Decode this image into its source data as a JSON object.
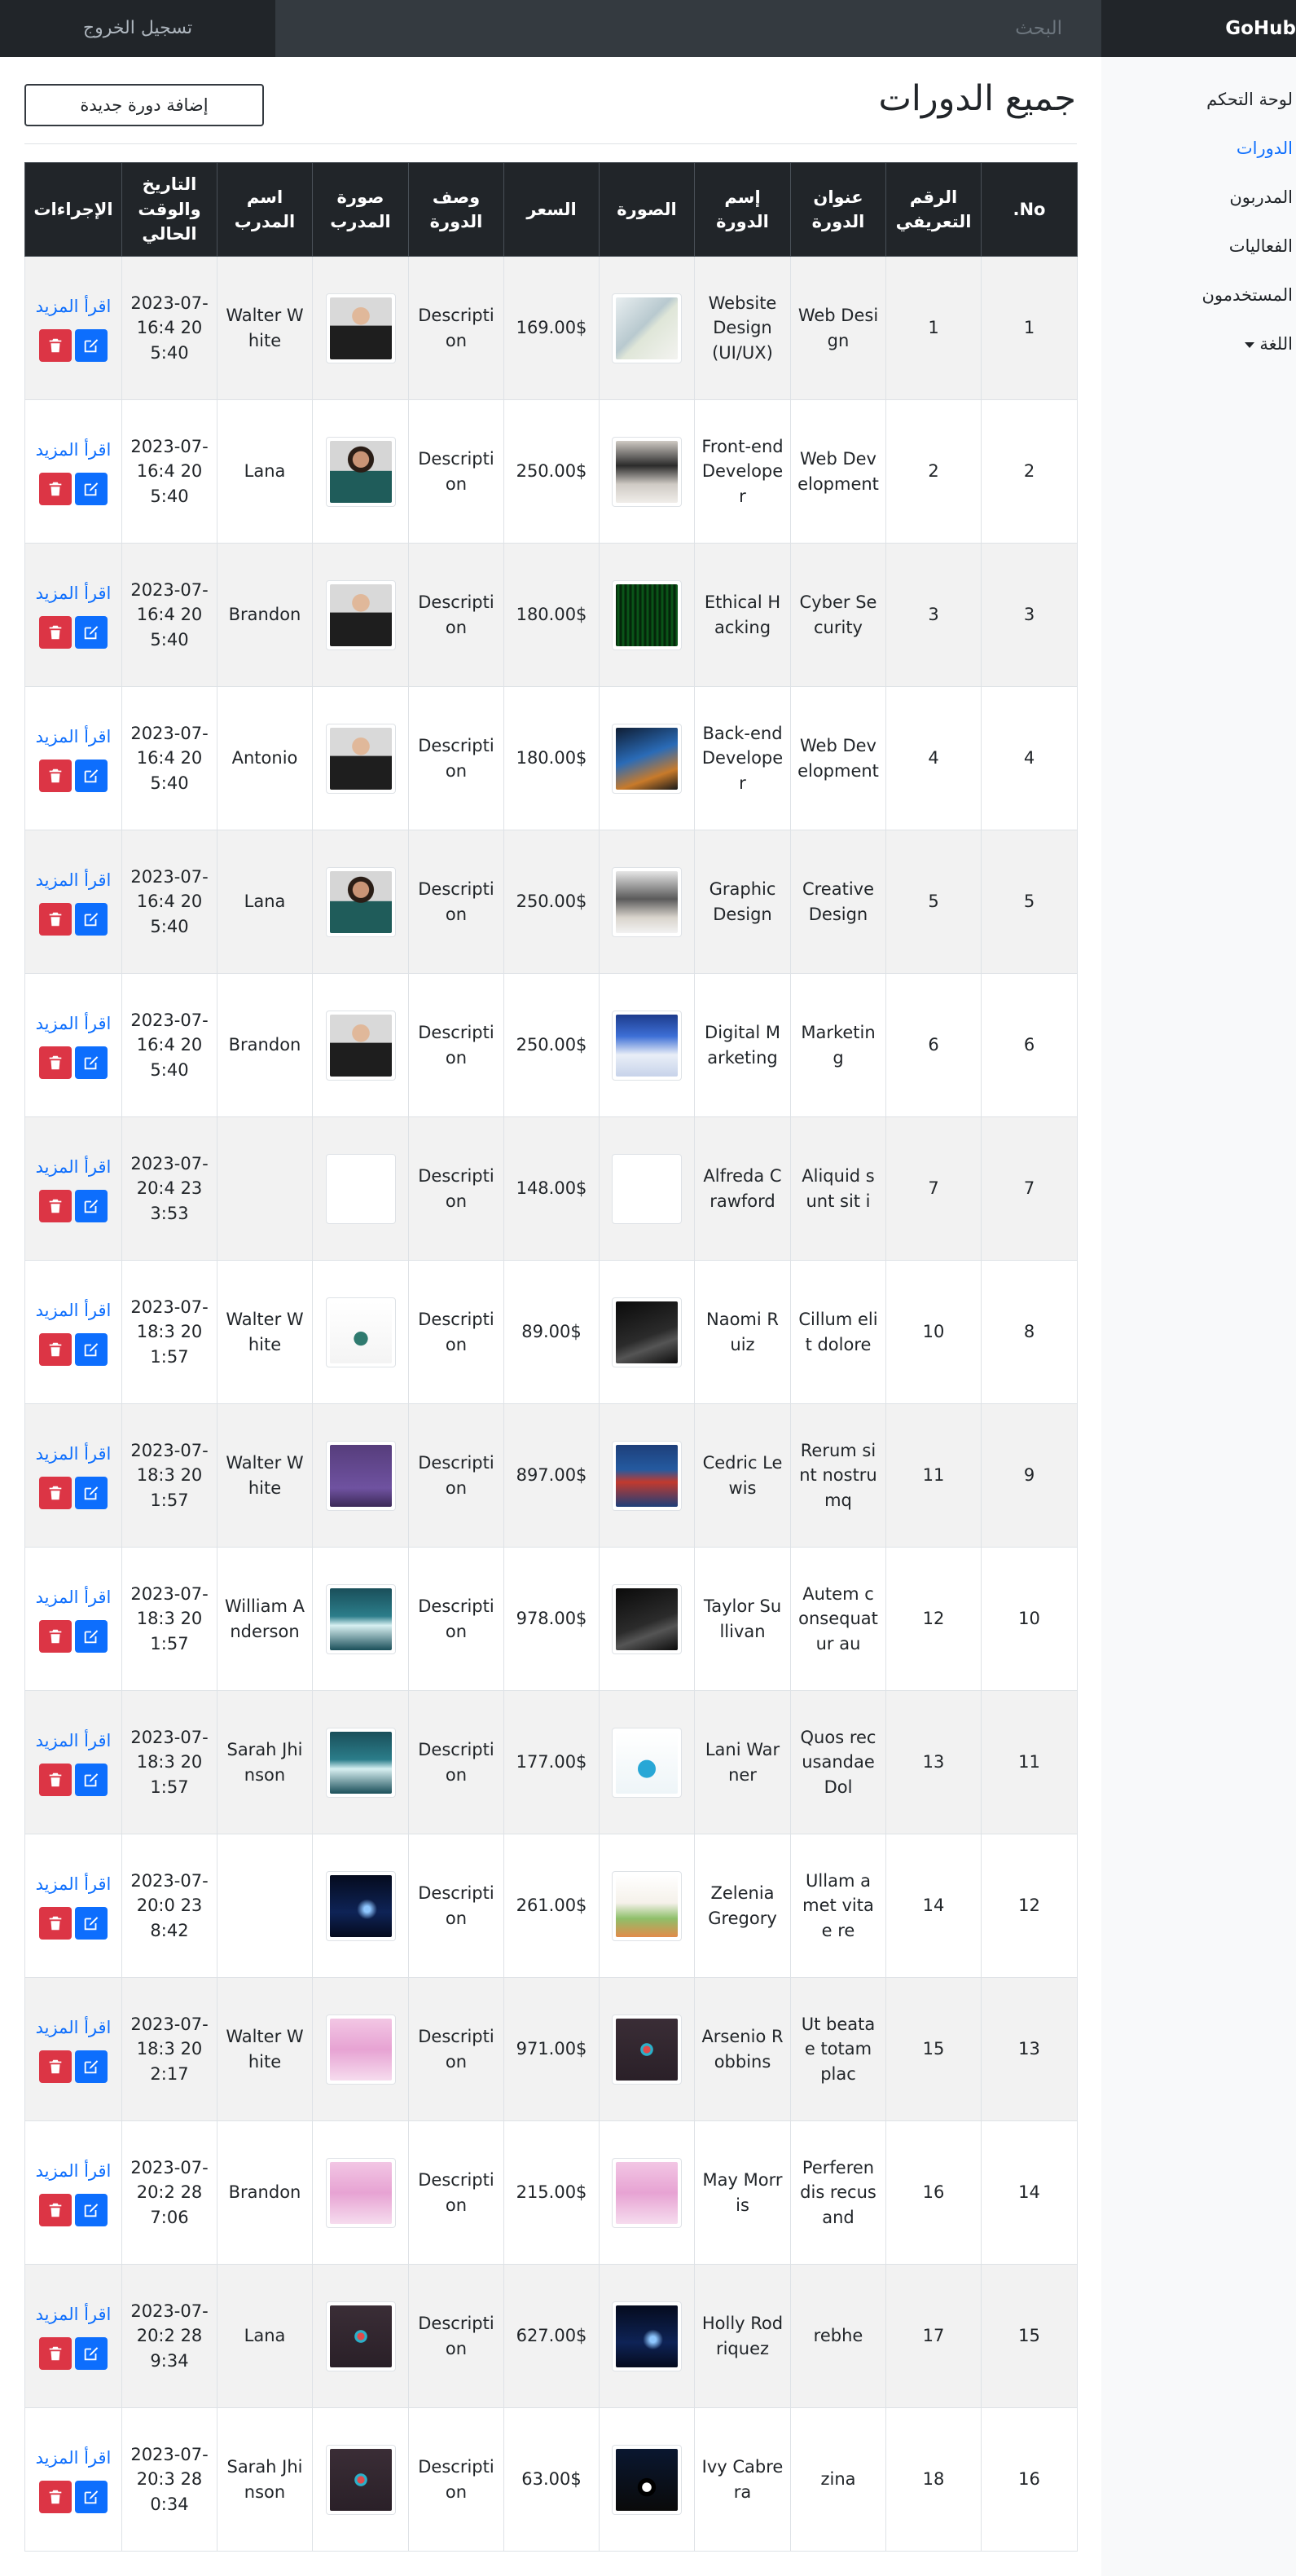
{
  "navbar": {
    "brand": "GoHub",
    "search_placeholder": "البحث",
    "logout": "تسجيل الخروج"
  },
  "sidebar": {
    "items": [
      {
        "label": "لوحة التحكم",
        "active": false
      },
      {
        "label": "الدورات",
        "active": true
      },
      {
        "label": "المدربون",
        "active": false
      },
      {
        "label": "الفعاليات",
        "active": false
      },
      {
        "label": "المستخدمون",
        "active": false
      }
    ],
    "language": "اللغة"
  },
  "main": {
    "title": "جميع الدورات",
    "add_button": "إضافة دورة جديدة",
    "columns": [
      "No.",
      "الرقم التعريفي",
      "عنوان الدورة",
      "إسم الدورة",
      "الصورة",
      "السعر",
      "وصف الدورة",
      "صورة المدرب",
      "اسم المدرب",
      "التاريخ والوقت الحالي",
      "الإجراءات"
    ],
    "read_more": "اقرأ المزيد",
    "rows": [
      {
        "no": "1",
        "id": "1",
        "title": "Web Design",
        "name": "Website Design (UI/UX)",
        "image": "website-design-photo",
        "price": "169.00$",
        "description": "Description",
        "trainer_image": "man-in-suit-photo",
        "trainer": "Walter White",
        "datetime": "2023-07-20 16:45:40"
      },
      {
        "no": "2",
        "id": "2",
        "title": "Web Development",
        "name": "Front-end Developer",
        "image": "desk-monitor-photo",
        "price": "250.00$",
        "description": "Description",
        "trainer_image": "woman-photo",
        "trainer": "Lana",
        "datetime": "2023-07-20 16:45:40"
      },
      {
        "no": "3",
        "id": "3",
        "title": "Cyber Security",
        "name": "Ethical Hacking",
        "image": "green-code-photo",
        "price": "180.00$",
        "description": "Description",
        "trainer_image": "man-in-suit-photo",
        "trainer": "Brandon",
        "datetime": "2023-07-20 16:45:40"
      },
      {
        "no": "4",
        "id": "4",
        "title": "Web Development",
        "name": "Back-end Developer",
        "image": "laptop-photo",
        "price": "180.00$",
        "description": "Description",
        "trainer_image": "man-in-suit-photo",
        "trainer": "Antonio",
        "datetime": "2023-07-20 16:45:40"
      },
      {
        "no": "5",
        "id": "5",
        "title": "Creative Design",
        "name": "Graphic Design",
        "image": "design-desk-photo",
        "price": "250.00$",
        "description": "Description",
        "trainer_image": "woman-photo",
        "trainer": "Lana",
        "datetime": "2023-07-20 16:45:40"
      },
      {
        "no": "6",
        "id": "6",
        "title": "Marketing",
        "name": "Digital Marketing",
        "image": "marketing-screen-photo",
        "price": "250.00$",
        "description": "Description",
        "trainer_image": "man-in-suit-photo",
        "trainer": "Brandon",
        "datetime": "2023-07-20 16:45:40"
      },
      {
        "no": "7",
        "id": "7",
        "title": "Aliquid sunt sit i",
        "name": "Alfreda Crawford",
        "image": "",
        "price": "148.00$",
        "description": "Description",
        "trainer_image": "",
        "trainer": "",
        "datetime": "2023-07-23 20:43:53"
      },
      {
        "no": "8",
        "id": "10",
        "title": "Cillum elit dolore",
        "name": "Naomi Ruiz",
        "image": "dark-book-cover",
        "price": "89.00$",
        "description": "Description",
        "trainer_image": "python-book-cover",
        "trainer": "Walter White",
        "datetime": "2023-07-20 18:31:57"
      },
      {
        "no": "9",
        "id": "11",
        "title": "Rerum sint nostrumq",
        "name": "Cedric Lewis",
        "image": "blue-red-book-cover",
        "price": "897.00$",
        "description": "Description",
        "trainer_image": "bootstrap-book-cover",
        "trainer": "Walter White",
        "datetime": "2023-07-20 18:31:57"
      },
      {
        "no": "10",
        "id": "12",
        "title": "Autem consequatur au",
        "name": "Taylor Sullivan",
        "image": "dark-book-cover",
        "price": "978.00$",
        "description": "Description",
        "trainer_image": "teal-book-cover",
        "trainer": "William Anderson",
        "datetime": "2023-07-20 18:31:57"
      },
      {
        "no": "11",
        "id": "13",
        "title": "Quos recusandae Dol",
        "name": "Lani Warner",
        "image": "white-cubes-book-cover",
        "price": "177.00$",
        "description": "Description",
        "trainer_image": "teal-book-cover",
        "trainer": "Sarah Jhinson",
        "datetime": "2023-07-20 18:31:57"
      },
      {
        "no": "12",
        "id": "14",
        "title": "Ullam amet vitae re",
        "name": "Zelenia Gregory",
        "image": "calligraphy-book-cover",
        "price": "261.00$",
        "description": "Description",
        "trainer_image": "space-book-cover",
        "trainer": "",
        "datetime": "2023-07-23 20:08:42"
      },
      {
        "no": "13",
        "id": "15",
        "title": "Ut beatae totam plac",
        "name": "Arsenio Robbins",
        "image": "dark-diamond-book-cover",
        "price": "971.00$",
        "description": "Description",
        "trainer_image": "pink-arabic-book-cover",
        "trainer": "Walter White",
        "datetime": "2023-07-20 18:32:17"
      },
      {
        "no": "14",
        "id": "16",
        "title": "Perferendis recusand",
        "name": "May Morris",
        "image": "pink-arabic-book-cover",
        "price": "215.00$",
        "description": "Description",
        "trainer_image": "pink-arabic-book-cover",
        "trainer": "Brandon",
        "datetime": "2023-07-28 20:27:06"
      },
      {
        "no": "15",
        "id": "17",
        "title": "rebhe",
        "name": "Holly Rodriquez",
        "image": "space-book-cover",
        "price": "627.00$",
        "description": "Description",
        "trainer_image": "dark-diamond-book-cover",
        "trainer": "Lana",
        "datetime": "2023-07-28 20:29:34"
      },
      {
        "no": "16",
        "id": "18",
        "title": "zina",
        "name": "Ivy Cabrera",
        "image": "eclipse-book-cover",
        "price": "63.00$",
        "description": "Description",
        "trainer_image": "dark-diamond-book-cover",
        "trainer": "Sarah Jhinson",
        "datetime": "2023-07-28 20:30:34"
      }
    ]
  },
  "colors": {
    "navbar": "#212529",
    "search_bg": "#343a40",
    "sidebar_bg": "#f8f9fa",
    "link": "#0d6efd",
    "delete": "#dc3545",
    "edit": "#0d6efd",
    "table_header": "#212529",
    "row_stripe": "#f2f2f2"
  }
}
